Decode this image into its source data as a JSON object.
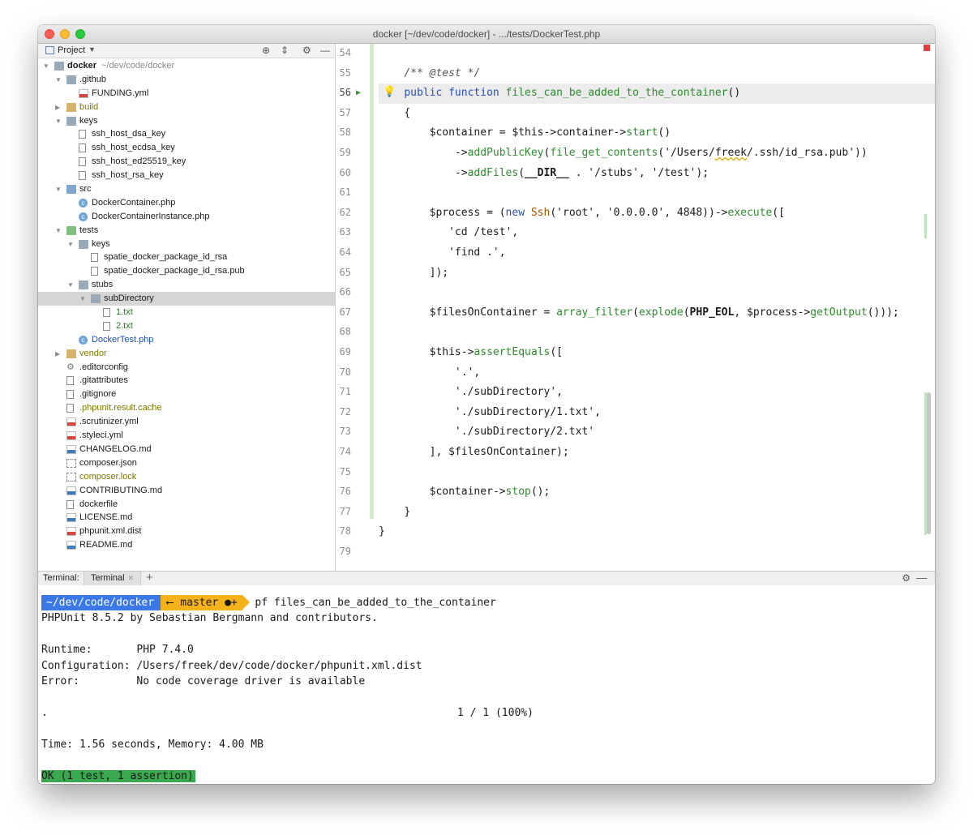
{
  "window": {
    "title": "docker [~/dev/code/docker] - .../tests/DockerTest.php"
  },
  "project_panel": {
    "header_label": "Project",
    "tree": [
      {
        "label": "docker",
        "suffix": "~/dev/code/docker",
        "type": "folder",
        "level": 0,
        "expanded": true
      },
      {
        "label": ".github",
        "type": "folder",
        "level": 1,
        "expanded": true
      },
      {
        "label": "FUNDING.yml",
        "type": "yml",
        "level": 2
      },
      {
        "label": "build",
        "type": "folder-excluded",
        "level": 1,
        "expanded": false
      },
      {
        "label": "keys",
        "type": "folder",
        "level": 1,
        "expanded": true
      },
      {
        "label": "ssh_host_dsa_key",
        "type": "file",
        "level": 2
      },
      {
        "label": "ssh_host_ecdsa_key",
        "type": "file",
        "level": 2
      },
      {
        "label": "ssh_host_ed25519_key",
        "type": "file",
        "level": 2
      },
      {
        "label": "ssh_host_rsa_key",
        "type": "file",
        "level": 2
      },
      {
        "label": "src",
        "type": "folder-src",
        "level": 1,
        "expanded": true
      },
      {
        "label": "DockerContainer.php",
        "type": "php",
        "level": 2
      },
      {
        "label": "DockerContainerInstance.php",
        "type": "php",
        "level": 2
      },
      {
        "label": "tests",
        "type": "folder-test",
        "level": 1,
        "expanded": true
      },
      {
        "label": "keys",
        "type": "folder",
        "level": 2,
        "expanded": true
      },
      {
        "label": "spatie_docker_package_id_rsa",
        "type": "file",
        "level": 3
      },
      {
        "label": "spatie_docker_package_id_rsa.pub",
        "type": "file",
        "level": 3
      },
      {
        "label": "stubs",
        "type": "folder",
        "level": 2,
        "expanded": true
      },
      {
        "label": "subDirectory",
        "type": "folder",
        "level": 3,
        "expanded": true,
        "selected": true
      },
      {
        "label": "1.txt",
        "type": "file-green",
        "level": 4
      },
      {
        "label": "2.txt",
        "type": "file-green",
        "level": 4
      },
      {
        "label": "DockerTest.php",
        "type": "php-blue",
        "level": 2
      },
      {
        "label": "vendor",
        "type": "folder-excluded",
        "level": 1,
        "expanded": false
      },
      {
        "label": ".editorconfig",
        "type": "gear",
        "level": 1
      },
      {
        "label": ".gitattributes",
        "type": "file",
        "level": 1
      },
      {
        "label": ".gitignore",
        "type": "file",
        "level": 1
      },
      {
        "label": ".phpunit.result.cache",
        "type": "file-olive",
        "level": 1
      },
      {
        "label": ".scrutinizer.yml",
        "type": "yml",
        "level": 1
      },
      {
        "label": ".styleci.yml",
        "type": "yml",
        "level": 1
      },
      {
        "label": "CHANGELOG.md",
        "type": "md",
        "level": 1
      },
      {
        "label": "composer.json",
        "type": "json",
        "level": 1
      },
      {
        "label": "composer.lock",
        "type": "json-olive",
        "level": 1
      },
      {
        "label": "CONTRIBUTING.md",
        "type": "md",
        "level": 1
      },
      {
        "label": "dockerfile",
        "type": "file",
        "level": 1
      },
      {
        "label": "LICENSE.md",
        "type": "md",
        "level": 1
      },
      {
        "label": "phpunit.xml.dist",
        "type": "xml",
        "level": 1
      },
      {
        "label": "README.md",
        "type": "md",
        "level": 1
      }
    ]
  },
  "editor": {
    "line_numbers": [
      "54",
      "55",
      "56",
      "57",
      "58",
      "59",
      "60",
      "61",
      "62",
      "63",
      "64",
      "65",
      "66",
      "67",
      "68",
      "69",
      "70",
      "71",
      "72",
      "73",
      "74",
      "75",
      "76",
      "77",
      "78",
      "79"
    ],
    "current_line": "56",
    "code": {
      "l55": "/** @test */",
      "l56_kw1": "public",
      "l56_kw2": "function",
      "l56_fn": "files_can_be_added_to_the_container",
      "l56_rest": "()",
      "l57": "{",
      "l58_a": "$container = $this->container->",
      "l58_fn": "start",
      "l58_b": "()",
      "l59_a": "->",
      "l59_fn1": "addPublicKey",
      "l59_b": "(",
      "l59_fn2": "file_get_contents",
      "l59_c": "('/Users/",
      "l59_sq": "freek",
      "l59_d": "/.ssh/id_rsa.pub'))",
      "l60_a": "->",
      "l60_fn": "addFiles",
      "l60_b": "(",
      "l60_const": "__DIR__",
      "l60_c": " . '/stubs', '/test');",
      "l62_a": "$process = (",
      "l62_kw": "new",
      "l62_cls": "Ssh",
      "l62_b": "('root', '0.0.0.0', 4848))->",
      "l62_fn": "execute",
      "l62_c": "([",
      "l63": "'cd /test',",
      "l64": "'find .',",
      "l65": "]);",
      "l67_a": "$filesOnContainer = ",
      "l67_fn1": "array_filter",
      "l67_b": "(",
      "l67_fn2": "explode",
      "l67_c": "(",
      "l67_const": "PHP_EOL",
      "l67_d": ", $process->",
      "l67_fn3": "getOutput",
      "l67_e": "()));",
      "l69_a": "$this->",
      "l69_fn": "assertEquals",
      "l69_b": "([",
      "l70": "'.',",
      "l71": "'./subDirectory',",
      "l72": "'./subDirectory/1.txt',",
      "l73": "'./subDirectory/2.txt'",
      "l74": "], $filesOnContainer);",
      "l76_a": "$container->",
      "l76_fn": "stop",
      "l76_b": "();",
      "l77": "}",
      "l78": "}"
    }
  },
  "terminal": {
    "header_label": "Terminal:",
    "tab_label": "Terminal",
    "prompt_path": "~/dev/code/docker",
    "prompt_branch": "master",
    "prompt_status": "●+",
    "command": "pf files_can_be_added_to_the_container",
    "lines": {
      "l1": "PHPUnit 8.5.2 by Sebastian Bergmann and contributors.",
      "l2": "Runtime:       PHP 7.4.0",
      "l3": "Configuration: /Users/freek/dev/code/docker/phpunit.xml.dist",
      "l4": "Error:         No code coverage driver is available",
      "l5_dot": ".",
      "l5_progress": "1 / 1 (100%)",
      "l6": "Time: 1.56 seconds, Memory: 4.00 MB",
      "ok": "OK (1 test, 1 assertion)"
    }
  },
  "colors": {
    "prompt_path_bg": "#3b78e7",
    "prompt_branch_bg": "#f6b21b",
    "ok_bg": "#3aa84e",
    "keyword": "#2b4fb5",
    "function": "#2e8b2e"
  }
}
